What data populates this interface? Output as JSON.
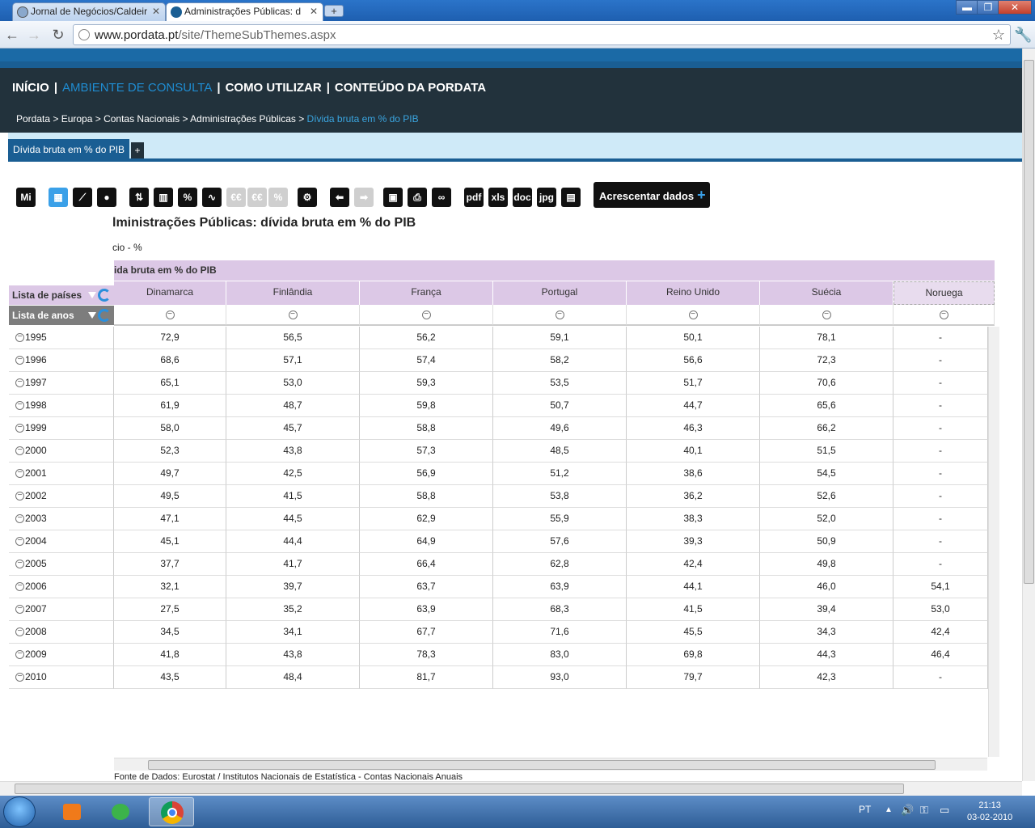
{
  "browser": {
    "tabs": [
      {
        "title": "Jornal de Negócios/Caldeir",
        "favicon": "globe-icon"
      },
      {
        "title": "Administrações Públicas: d",
        "favicon": "pordata-icon"
      }
    ],
    "new_tab": "+",
    "url_host": "www.pordata.pt",
    "url_path": "/site/ThemeSubThemes.aspx"
  },
  "nav": {
    "items": [
      "INÍCIO",
      "AMBIENTE DE CONSULTA",
      "COMO UTILIZAR",
      "CONTEÚDO DA PORDATA"
    ],
    "separator": "|"
  },
  "breadcrumb": {
    "path": "Pordata > Europa > Contas Nacionais > Administrações Públicas > ",
    "current": "Dívida bruta em % do PIB"
  },
  "page_tab": {
    "label": "Dívida bruta em % do PIB",
    "add": "+"
  },
  "toolbar": {
    "icons": [
      "Mi",
      "pdf",
      "xls",
      "doc",
      "jpg"
    ],
    "add_data_label": "Acrescentar dados",
    "add_data_plus": "+"
  },
  "report": {
    "title": "lministrações Públicas: dívida bruta em % do PIB",
    "unit": "cio - %",
    "indicator": "ida bruta em % do PIB",
    "lista_paises": "Lista de países",
    "lista_anos": "Lista de anos",
    "columns": [
      "Dinamarca",
      "Finlândia",
      "França",
      "Portugal",
      "Reino Unido",
      "Suécia",
      "Noruega"
    ],
    "rows": [
      {
        "year": "1995",
        "values": [
          "72,9",
          "56,5",
          "56,2",
          "59,1",
          "50,1",
          "78,1",
          "-"
        ]
      },
      {
        "year": "1996",
        "values": [
          "68,6",
          "57,1",
          "57,4",
          "58,2",
          "56,6",
          "72,3",
          "-"
        ]
      },
      {
        "year": "1997",
        "values": [
          "65,1",
          "53,0",
          "59,3",
          "53,5",
          "51,7",
          "70,6",
          "-"
        ]
      },
      {
        "year": "1998",
        "values": [
          "61,9",
          "48,7",
          "59,8",
          "50,7",
          "44,7",
          "65,6",
          "-"
        ]
      },
      {
        "year": "1999",
        "values": [
          "58,0",
          "45,7",
          "58,8",
          "49,6",
          "46,3",
          "66,2",
          "-"
        ]
      },
      {
        "year": "2000",
        "values": [
          "52,3",
          "43,8",
          "57,3",
          "48,5",
          "40,1",
          "51,5",
          "-"
        ]
      },
      {
        "year": "2001",
        "values": [
          "49,7",
          "42,5",
          "56,9",
          "51,2",
          "38,6",
          "54,5",
          "-"
        ]
      },
      {
        "year": "2002",
        "values": [
          "49,5",
          "41,5",
          "58,8",
          "53,8",
          "36,2",
          "52,6",
          "-"
        ]
      },
      {
        "year": "2003",
        "values": [
          "47,1",
          "44,5",
          "62,9",
          "55,9",
          "38,3",
          "52,0",
          "-"
        ]
      },
      {
        "year": "2004",
        "values": [
          "45,1",
          "44,4",
          "64,9",
          "57,6",
          "39,3",
          "50,9",
          "-"
        ]
      },
      {
        "year": "2005",
        "values": [
          "37,7",
          "41,7",
          "66,4",
          "62,8",
          "42,4",
          "49,8",
          "-"
        ]
      },
      {
        "year": "2006",
        "values": [
          "32,1",
          "39,7",
          "63,7",
          "63,9",
          "44,1",
          "46,0",
          "54,1"
        ]
      },
      {
        "year": "2007",
        "values": [
          "27,5",
          "35,2",
          "63,9",
          "68,3",
          "41,5",
          "39,4",
          "53,0"
        ]
      },
      {
        "year": "2008",
        "values": [
          "34,5",
          "34,1",
          "67,7",
          "71,6",
          "45,5",
          "34,3",
          "42,4"
        ]
      },
      {
        "year": "2009",
        "values": [
          "41,8",
          "43,8",
          "78,3",
          "83,0",
          "69,8",
          "44,3",
          "46,4"
        ]
      },
      {
        "year": "2010",
        "values": [
          "43,5",
          "48,4",
          "81,7",
          "93,0",
          "79,7",
          "42,3",
          "-"
        ]
      }
    ],
    "source": "Fonte de Dados: Eurostat / Institutos Nacionais de Estatística - Contas Nacionais Anuais"
  },
  "taskbar": {
    "lang": "PT",
    "time": "21:13",
    "date": "03-02-2010"
  }
}
